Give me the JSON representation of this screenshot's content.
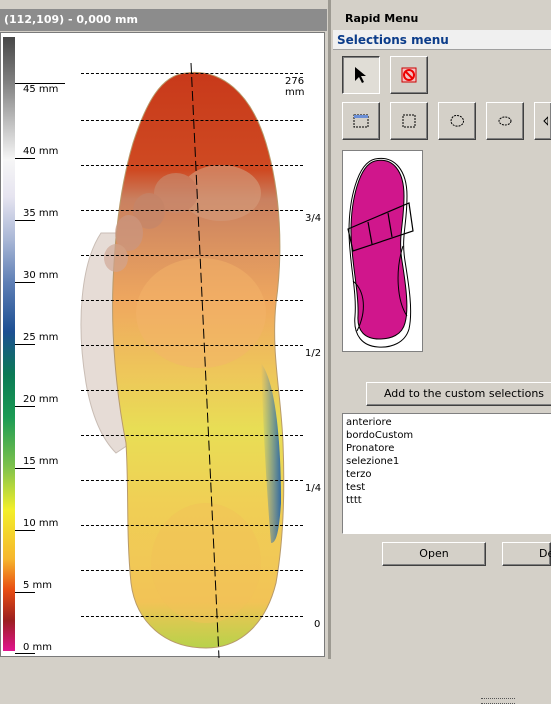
{
  "viewer": {
    "coords_readout": "(112,109) - 0,000 mm",
    "scale_labels": [
      "45 mm",
      "40 mm",
      "35 mm",
      "30 mm",
      "25 mm",
      "20 mm",
      "15 mm",
      "10 mm",
      "5 mm",
      "0 mm"
    ],
    "guide_labels": [
      "276 mm",
      "3/4",
      "1/2",
      "1/4",
      "0"
    ]
  },
  "rapid_menu": {
    "title": "Rapid Menu",
    "section_title": "Selections menu",
    "add_button_label": "Add to the custom selections",
    "open_button_label": "Open",
    "delete_button_label": "De",
    "custom_selections": [
      "anteriore",
      "bordoCustom",
      "Pronatore",
      "selezione1",
      "terzo",
      "test",
      "tttt"
    ],
    "colors": {
      "insole_magenta": "#d0168c",
      "section_title": "#0b3c8a"
    }
  }
}
